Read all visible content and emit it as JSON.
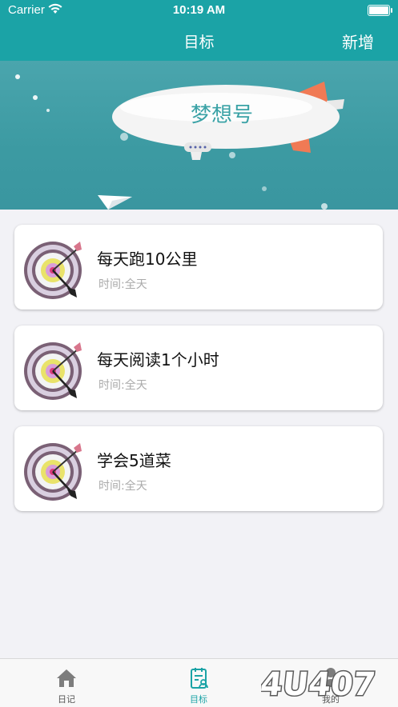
{
  "status_bar": {
    "carrier": "Carrier",
    "time": "10:19 AM"
  },
  "nav": {
    "title": "目标",
    "add_button": "新增"
  },
  "banner": {
    "airship_text": "梦想号"
  },
  "goals": [
    {
      "title": "每天跑10公里",
      "time": "时间:全天"
    },
    {
      "title": "每天阅读1个小时",
      "time": "时间:全天"
    },
    {
      "title": "学会5道菜",
      "time": "时间:全天"
    }
  ],
  "tabs": [
    {
      "label": "日记",
      "icon": "home-icon",
      "active": false
    },
    {
      "label": "目标",
      "icon": "goal-list-icon",
      "active": true
    },
    {
      "label": "我的",
      "icon": "profile-icon",
      "active": false
    }
  ],
  "watermark": {
    "text": "4U407"
  },
  "colors": {
    "primary": "#1ba3a6",
    "background": "#f2f2f6"
  }
}
